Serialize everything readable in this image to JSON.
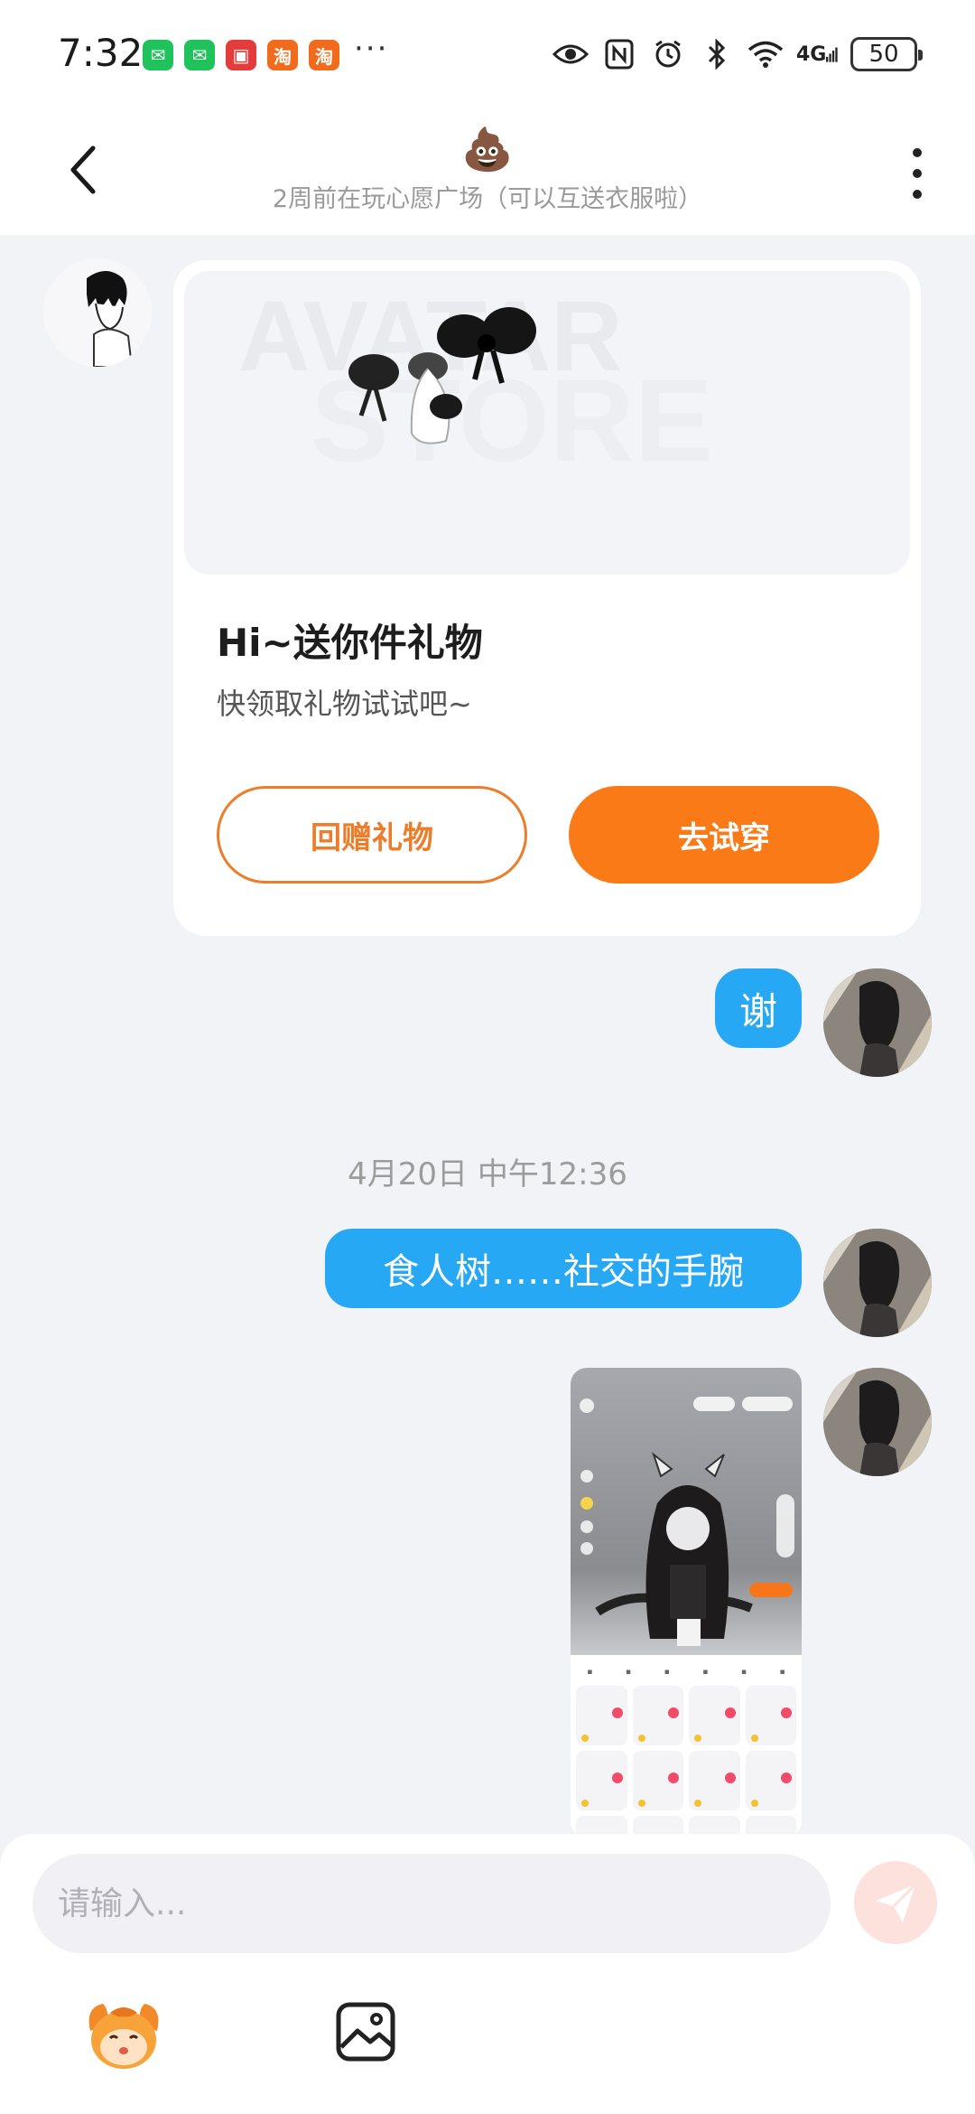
{
  "status_bar": {
    "time": "7:32",
    "apps": [
      {
        "icon": "wechat-icon",
        "glyph": "✉",
        "color": "#1fc25b"
      },
      {
        "icon": "wechat-icon",
        "glyph": "✉",
        "color": "#1fc25b"
      },
      {
        "icon": "red-app-icon",
        "glyph": "▣",
        "color": "#e63b3b"
      },
      {
        "icon": "taobao-icon",
        "glyph": "淘",
        "color": "#f26a1b"
      },
      {
        "icon": "taobao-icon",
        "glyph": "淘",
        "color": "#f26a1b"
      }
    ],
    "more": "···",
    "network": "4G",
    "battery": "50"
  },
  "header": {
    "emoji": "💩",
    "subtitle": "2周前在玩心愿广场（可以互送衣服啦）"
  },
  "gift_card": {
    "title": "Hi~送你件礼物",
    "subtitle": "快领取礼物试试吧~",
    "return_label": "回赠礼物",
    "try_label": "去试穿",
    "banner_text_1": "AVATAR",
    "banner_text_2": "STORE"
  },
  "messages": {
    "thanks": "谢",
    "timestamp": "4月20日 中午12:36",
    "text2": "食人树……社交的手腕"
  },
  "input": {
    "placeholder": "请输入..."
  },
  "colors": {
    "accent_orange": "#f97a16",
    "bubble_blue": "#26a8f4"
  }
}
